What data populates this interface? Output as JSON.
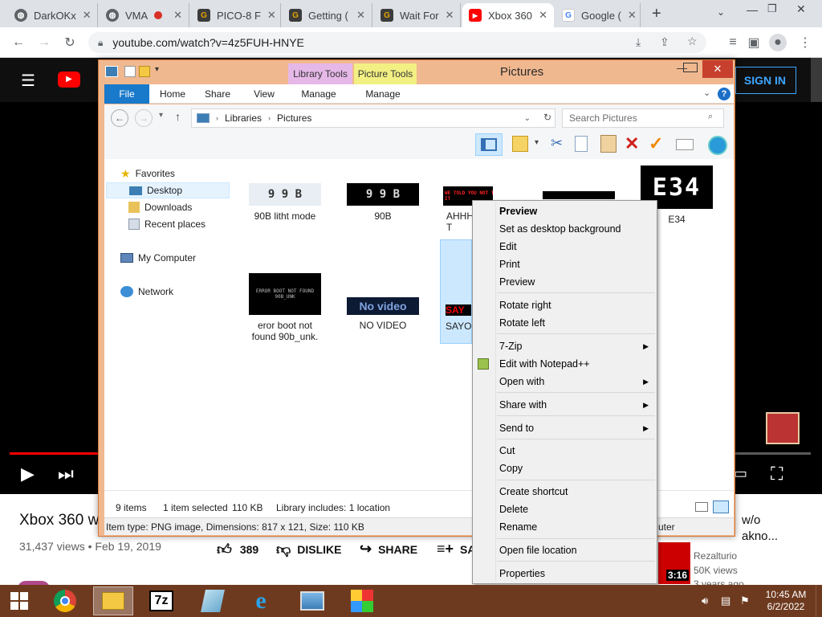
{
  "browser": {
    "tabs": [
      {
        "title": "DarkOKx",
        "favicon": "globe-icon"
      },
      {
        "title": "VMA",
        "favicon": "globe-icon"
      },
      {
        "title": "PICO-8 F",
        "favicon": "g-icon"
      },
      {
        "title": "Getting (",
        "favicon": "g-icon"
      },
      {
        "title": "Wait For",
        "favicon": "g-icon"
      },
      {
        "title": "Xbox 360",
        "favicon": "youtube-icon"
      },
      {
        "title": "Google (",
        "favicon": "google-icon"
      }
    ],
    "new_tab_label": "+",
    "url": "youtube.com/watch?v=4z5FUH-HNYE"
  },
  "youtube": {
    "sign_in": "SIGN IN",
    "video_title": "Xbox 360 w/",
    "views": "31,437 views • Feb 19, 2019",
    "likes": "389",
    "dislike": "DISLIKE",
    "share": "SHARE",
    "save": "SA",
    "side_title_1": "w/o",
    "side_title_2": "akno...",
    "side_channel": "Rezalturio",
    "side_views": "50K views",
    "side_age": "3 years ago",
    "side_duration": "3:16",
    "obscured_status": "uter"
  },
  "explorer": {
    "title": "Pictures",
    "contextual_tab_1": "Library Tools",
    "contextual_tab_2": "Picture Tools",
    "ribbon_tabs": [
      "File",
      "Home",
      "Share",
      "View",
      "Manage",
      "Manage"
    ],
    "breadcrumb": [
      "Libraries",
      "Pictures"
    ],
    "search_placeholder": "Search Pictures",
    "nav": {
      "favorites": "Favorites",
      "desktop": "Desktop",
      "downloads": "Downloads",
      "recent": "Recent places",
      "computer": "My Computer",
      "network": "Network"
    },
    "files": [
      {
        "name": "90B litht mode",
        "thumb_text": "9 9 B"
      },
      {
        "name": "90B",
        "thumb_text": "9 9 B"
      },
      {
        "name": "AHHH TO T",
        "thumb_text": "WE TOLD YOU NOT TO TURN IT"
      },
      {
        "name": "E34",
        "thumb_text": "E34"
      },
      {
        "name": "eror boot not found 90b_unk.",
        "thumb_text": "ERROR   BOOT NOT FOUND   90B_UNK"
      },
      {
        "name": "NO VIDEO",
        "thumb_text": "No video"
      },
      {
        "name": "SAYO",
        "thumb_text": "SAY"
      }
    ],
    "status": {
      "items": "9 items",
      "selected": "1 item selected",
      "size": "110 KB",
      "library": "Library includes: 1 location"
    },
    "details": "Item type: PNG image, Dimensions: 817 x 121, Size: 110 KB"
  },
  "context_menu": {
    "items": [
      "Preview",
      "Set as desktop background",
      "Edit",
      "Print",
      "Preview",
      "Rotate right",
      "Rotate left",
      "7-Zip",
      "Edit with Notepad++",
      "Open with",
      "Share with",
      "Send to",
      "Cut",
      "Copy",
      "Create shortcut",
      "Delete",
      "Rename",
      "Open file location",
      "Properties"
    ]
  },
  "taskbar": {
    "time": "10:45 AM",
    "date": "6/2/2022",
    "sevenzip_label": "7z"
  },
  "colors": {
    "explorer_frame": "#f0b88f",
    "taskbar": "#6e3a1f",
    "youtube_red": "#ff0000",
    "selection": "#cce8ff"
  }
}
